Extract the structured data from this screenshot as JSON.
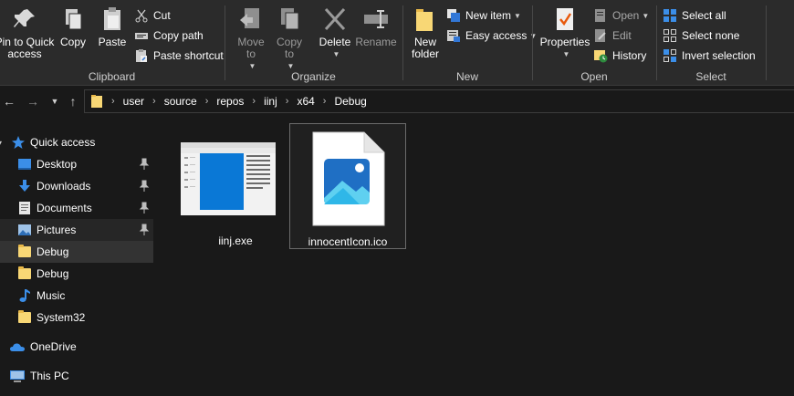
{
  "ribbon": {
    "clipboard": {
      "label": "Clipboard",
      "pin_to_quick_access": "Pin to Quick access",
      "copy": "Copy",
      "paste": "Paste",
      "cut": "Cut",
      "copy_path": "Copy path",
      "paste_shortcut": "Paste shortcut"
    },
    "organize": {
      "label": "Organize",
      "move_to": "Move to",
      "copy_to": "Copy to",
      "delete": "Delete",
      "rename": "Rename"
    },
    "new": {
      "label": "New",
      "new_folder": "New folder",
      "new_item": "New item",
      "easy_access": "Easy access"
    },
    "open": {
      "label": "Open",
      "properties": "Properties",
      "open": "Open",
      "edit": "Edit",
      "history": "History"
    },
    "select": {
      "label": "Select",
      "select_all": "Select all",
      "select_none": "Select none",
      "invert_selection": "Invert selection"
    }
  },
  "address": {
    "crumbs": [
      "user",
      "source",
      "repos",
      "iinj",
      "x64",
      "Debug"
    ]
  },
  "navpane": {
    "quick_access": "Quick access",
    "items": [
      {
        "label": "Desktop",
        "icon": "desktop-icon",
        "pinned": true
      },
      {
        "label": "Downloads",
        "icon": "download-icon",
        "pinned": true
      },
      {
        "label": "Documents",
        "icon": "documents-icon",
        "pinned": true
      },
      {
        "label": "Pictures",
        "icon": "pictures-icon",
        "pinned": true
      },
      {
        "label": "Debug",
        "icon": "folder-icon",
        "pinned": false
      },
      {
        "label": "Debug",
        "icon": "folder-icon",
        "pinned": false
      },
      {
        "label": "Music",
        "icon": "music-icon",
        "pinned": false
      },
      {
        "label": "System32",
        "icon": "folder-icon",
        "pinned": false
      }
    ],
    "onedrive": "OneDrive",
    "this_pc": "This PC"
  },
  "files": [
    {
      "name": "iinj.exe",
      "type": "exe"
    },
    {
      "name": "innocentIcon.ico",
      "type": "ico",
      "selected": true
    }
  ],
  "colors": {
    "background": "#191919",
    "ribbon": "#2b2b2b",
    "folder": "#f8d775",
    "accent": "#0078d7"
  }
}
